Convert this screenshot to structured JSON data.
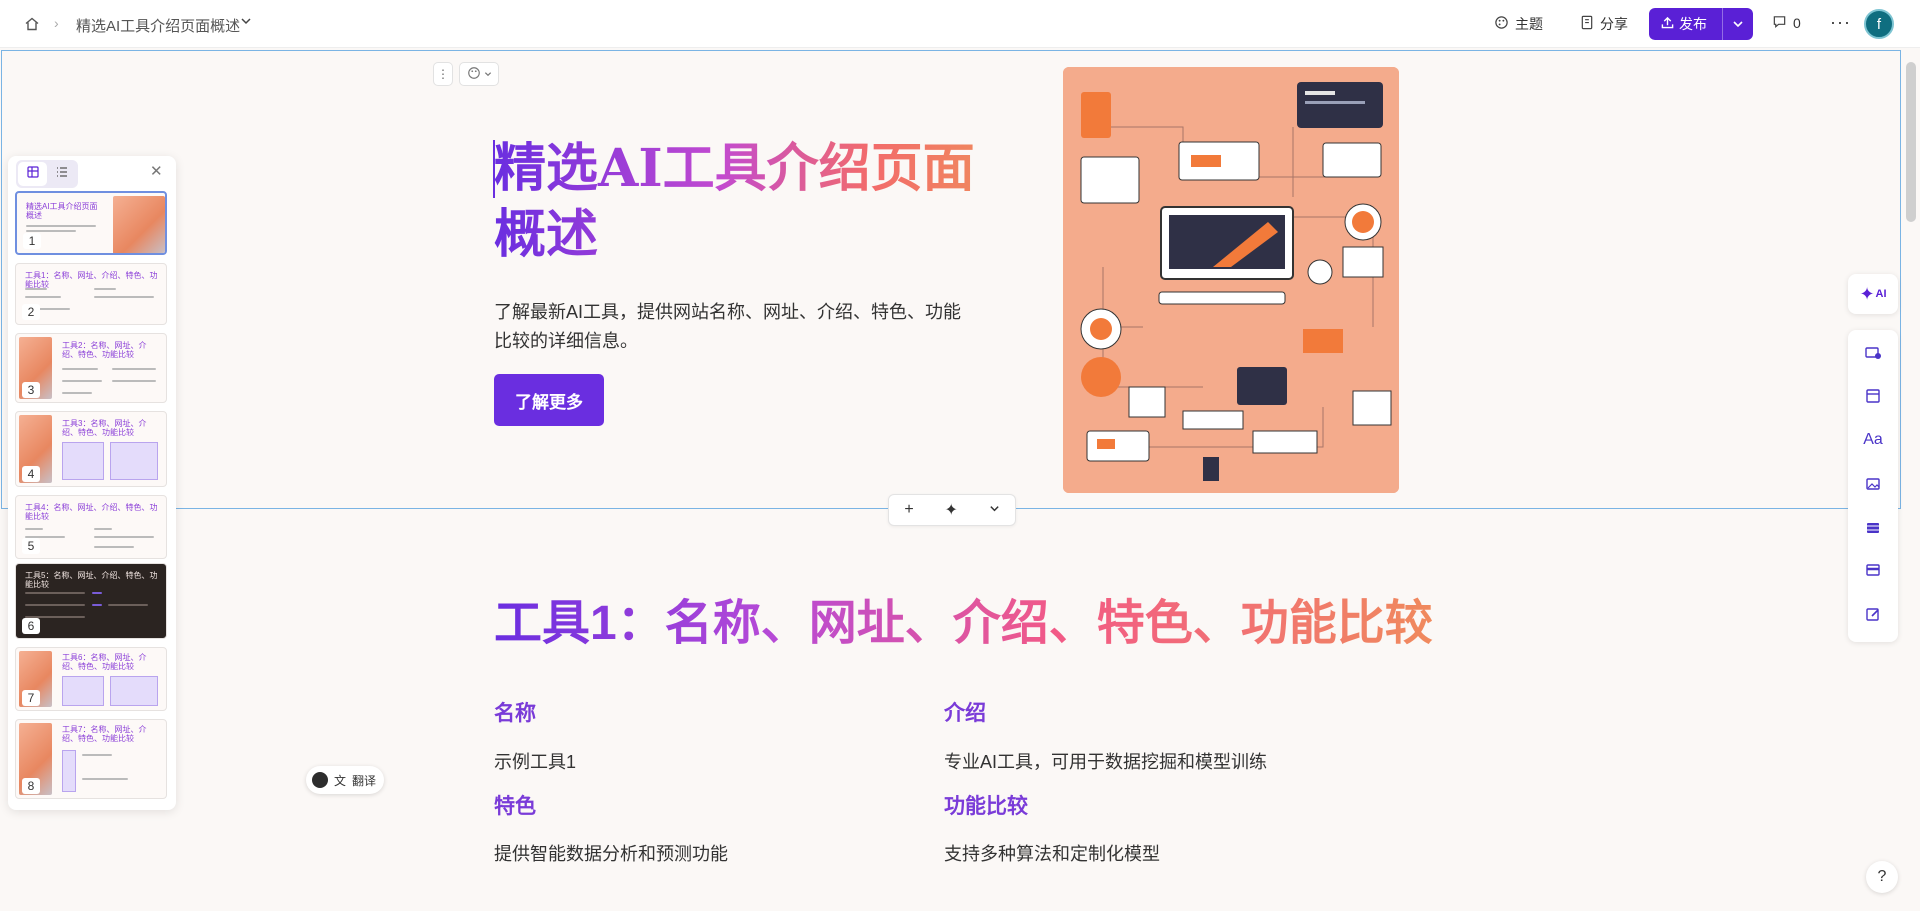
{
  "header": {
    "doc_title": "精选AI工具介绍页面概述",
    "theme_label": "主题",
    "share_label": "分享",
    "publish_label": "发布",
    "comment_count": "0",
    "avatar_initial": "f"
  },
  "hero": {
    "title": "精选AI工具介绍页面概述",
    "description": "了解最新AI工具，提供网站名称、网址、介绍、特色、功能比较的详细信息。",
    "button_label": "了解更多"
  },
  "section1": {
    "title": "工具1：名称、网址、介绍、特色、功能比较",
    "fields": [
      {
        "label": "名称",
        "value": "示例工具1"
      },
      {
        "label": "介绍",
        "value": "专业AI工具，可用于数据挖掘和模型训练"
      },
      {
        "label": "特色",
        "value": "提供智能数据分析和预测功能"
      },
      {
        "label": "功能比较",
        "value": "支持多种算法和定制化模型"
      }
    ]
  },
  "thumbnails": [
    {
      "num": "1",
      "title": "精选AI工具介绍页面概述"
    },
    {
      "num": "2",
      "title": "工具1：名称、网址、介绍、特色、功能比较"
    },
    {
      "num": "3",
      "title": "工具2：名称、网址、介绍、特色、功能比较"
    },
    {
      "num": "4",
      "title": "工具3：名称、网址、介绍、特色、功能比较"
    },
    {
      "num": "5",
      "title": "工具4：名称、网址、介绍、特色、功能比较"
    },
    {
      "num": "6",
      "title": "工具5：名称、网址、介绍、特色、功能比较"
    },
    {
      "num": "7",
      "title": "工具6：名称、网址、介绍、特色、功能比较"
    },
    {
      "num": "8",
      "title": "工具7：名称、网址、介绍、特色、功能比较"
    }
  ],
  "translate_label": "翻译",
  "ai_label": "AI",
  "help_label": "?",
  "colors": {
    "accent": "#5a20d6",
    "button": "#6a2ee0",
    "gradient_start": "#6a2ee0",
    "gradient_end": "#f08a5d",
    "hero_bg": "#f4ab8c"
  }
}
